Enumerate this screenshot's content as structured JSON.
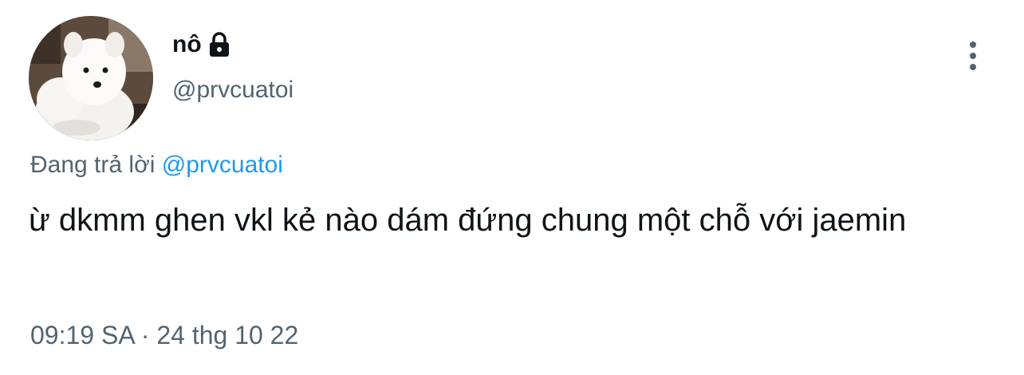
{
  "author": {
    "display_name": "nô",
    "handle": "@prvcuatoi",
    "verified_icon": "lock-icon",
    "avatar": "white-samoyed-puppy"
  },
  "menu": {
    "icon": "more-vertical-icon"
  },
  "reply": {
    "prefix": "Đang trả lời",
    "mention": "@prvcuatoi"
  },
  "tweet": {
    "text": "ừ dkmm ghen vkl kẻ nào dám đứng chung một chỗ với jaemin",
    "timestamp": "09:19 SA · 24 thg 10 22"
  },
  "colors": {
    "text": "#0f1419",
    "secondary": "#536471",
    "link": "#1d9bf0"
  }
}
